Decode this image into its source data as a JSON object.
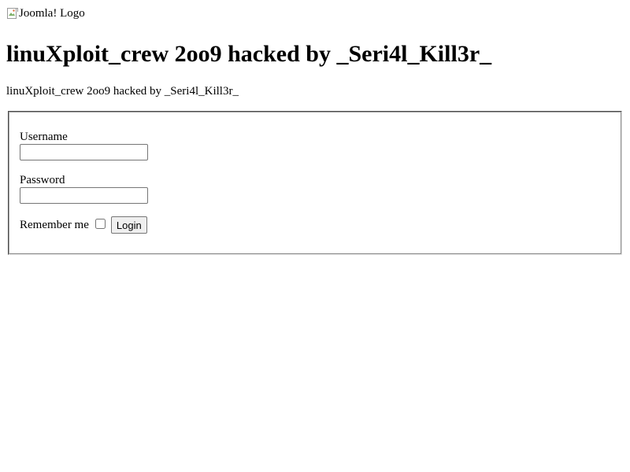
{
  "header": {
    "logo_alt": "Joomla! Logo",
    "title": "linuXploit_crew 2oo9 hacked by _Seri4l_Kill3r_"
  },
  "main": {
    "text": "linuXploit_crew 2oo9 hacked by _Seri4l_Kill3r_"
  },
  "login": {
    "username_label": "Username",
    "username_value": "",
    "password_label": "Password",
    "password_value": "",
    "remember_label": "Remember me",
    "remember_checked": false,
    "login_label": "Login"
  },
  "icons": {
    "logo": "broken-image-icon"
  },
  "colors": {
    "background": "#ffffff",
    "text": "#000000",
    "fieldset_border": "#a0a0a0"
  }
}
